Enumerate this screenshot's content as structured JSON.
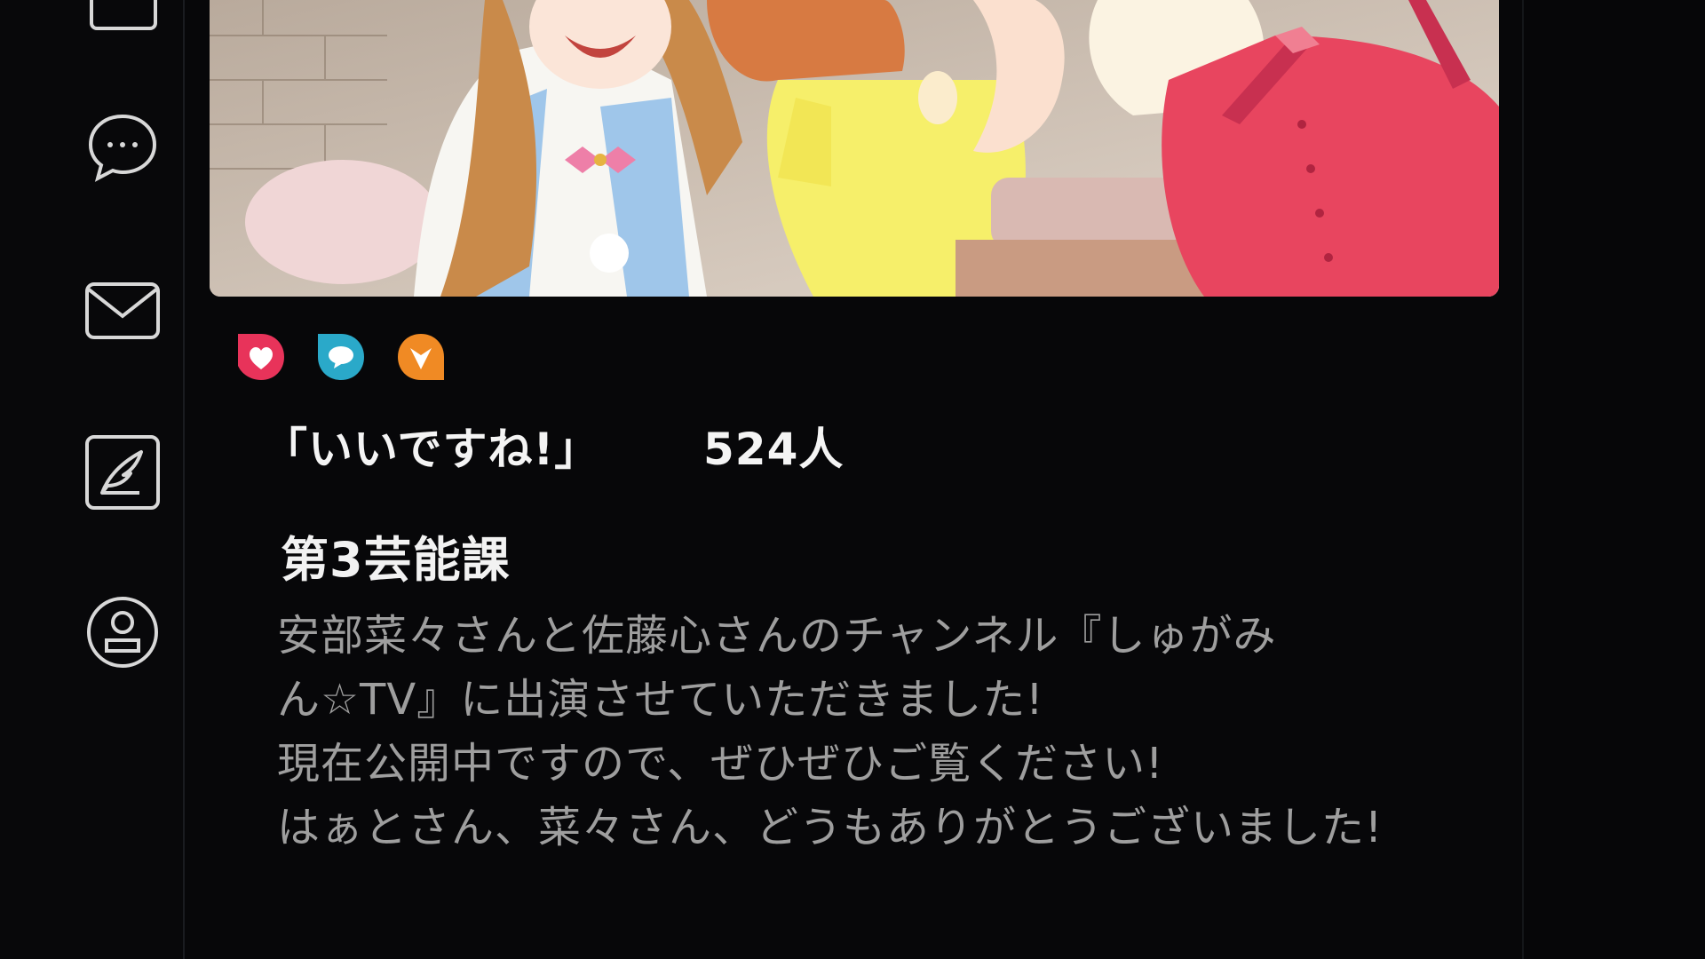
{
  "sidebar": {
    "icons": [
      {
        "name": "mail-icon-partial"
      },
      {
        "name": "chat-bubble-icon"
      },
      {
        "name": "envelope-icon"
      },
      {
        "name": "compose-quill-icon"
      },
      {
        "name": "profile-icon"
      }
    ]
  },
  "post": {
    "reactions": [
      {
        "name": "heart-reaction-icon",
        "color": "#e8335a"
      },
      {
        "name": "comment-reaction-icon",
        "color": "#2aa9c9"
      },
      {
        "name": "share-reaction-icon",
        "color": "#f08a24"
      }
    ],
    "like_label": "「いいですね!」",
    "like_count": "524人",
    "author": "第3芸能課",
    "body_lines": [
      "安部菜々さんと佐藤心さんのチャンネル『しゅがみ",
      "ん☆TV』に出演させていただきました!",
      "現在公開中ですので、ぜひぜひご覧ください!",
      "はぁとさん、菜々さん、どうもありがとうございました!"
    ]
  },
  "colors": {
    "background": "#070709",
    "icon_stroke": "#d8d8d8",
    "body_text": "#9e9e9e"
  }
}
